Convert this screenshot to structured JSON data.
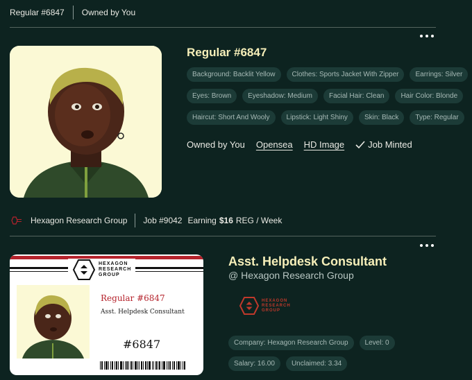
{
  "top_bar": {
    "item_name": "Regular #6847",
    "ownership": "Owned by You"
  },
  "item": {
    "title": "Regular #6847",
    "traits": [
      "Background: Backlit Yellow",
      "Clothes: Sports Jacket With Zipper",
      "Earrings: Silver",
      "Eyes: Brown",
      "Eyeshadow: Medium",
      "Facial Hair: Clean",
      "Hair Color: Blonde",
      "Haircut: Short And Wooly",
      "Lipstick: Light Shiny",
      "Skin: Black",
      "Type: Regular"
    ],
    "owned_label": "Owned by You",
    "opensea_link": "Opensea",
    "hd_image_link": "HD Image",
    "job_minted_label": "Job Minted"
  },
  "job_bar": {
    "company": "Hexagon Research Group",
    "job_number": "Job #9042",
    "earning_prefix": "Earning",
    "earning_amount": "$16",
    "earning_suffix": "REG / Week"
  },
  "id_card": {
    "brand_line1": "HEXAGON",
    "brand_line2": "RESEARCH",
    "brand_line3": "GROUP",
    "name": "Regular #6847",
    "role": "Asst. Helpdesk Consultant",
    "number": "#6847"
  },
  "job": {
    "title": "Asst. Helpdesk Consultant",
    "company_line": "@ Hexagon Research Group",
    "logo_line1": "HEXAGON",
    "logo_line2": "RESEARCH",
    "logo_line3": "GROUP",
    "stats": [
      "Company: Hexagon Research Group",
      "Level: 0",
      "Salary: 16.00",
      "Unclaimed: 3.34"
    ]
  },
  "colors": {
    "background": "#0d2320",
    "chip_bg": "#1c3b37",
    "title": "#f6efb9",
    "brand_red": "#b5232c"
  }
}
